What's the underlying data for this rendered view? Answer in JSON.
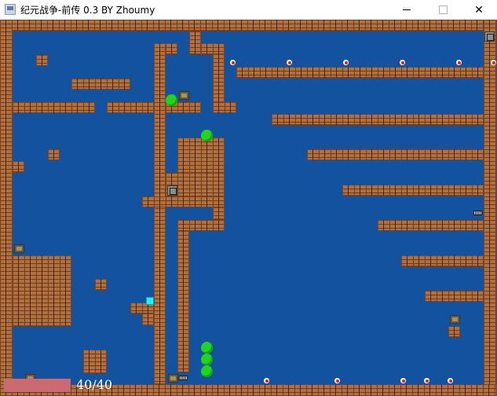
{
  "window": {
    "title": "纪元战争-前传 0.3 BY Zhoumy",
    "controls": {
      "minimize": "minimize-icon",
      "maximize": "maximize-icon",
      "close": "close-icon"
    },
    "close_glyph": "✕"
  },
  "colors": {
    "background": "#12529e",
    "brick": "#b3703f",
    "ball": "#21d51a",
    "player": "#1ff0ff",
    "hp_bar": "#c96b71"
  },
  "status": {
    "hp": "40/40"
  },
  "entities": {
    "balls": 5,
    "red_gems": 10,
    "crates": 5,
    "vaults": 2,
    "grates": 2,
    "player": "cyan-square"
  }
}
